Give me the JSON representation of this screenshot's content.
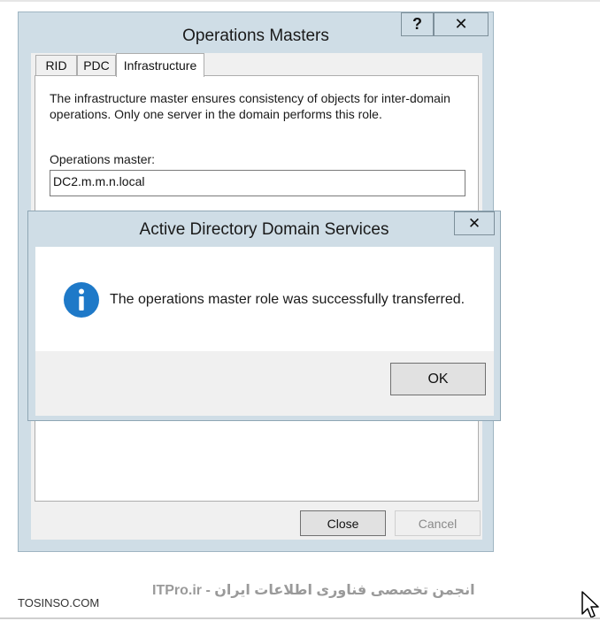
{
  "main_window": {
    "title": "Operations Masters",
    "help_label": "?",
    "close_label": "✕",
    "tabs": [
      {
        "label": "RID"
      },
      {
        "label": "PDC"
      },
      {
        "label": "Infrastructure"
      }
    ],
    "description": "The infrastructure master ensures consistency of objects for inter-domain operations. Only one server in the domain performs this role.",
    "operations_master_label": "Operations master:",
    "operations_master_value": "DC2.m.m.n.local",
    "close_button": "Close",
    "cancel_button": "Cancel"
  },
  "dialog": {
    "title": "Active Directory Domain Services",
    "close_label": "✕",
    "icon": "info-icon",
    "message": "The operations master role was successfully transferred.",
    "ok_button": "OK"
  },
  "footer": {
    "left_text": "TOSINSO.COM",
    "center_text": "ITPro.ir - انجمن تخصصی فناوری اطلاعات ایران"
  },
  "colors": {
    "title_bar": "#cfdde6",
    "info_icon": "#1e79c8"
  }
}
